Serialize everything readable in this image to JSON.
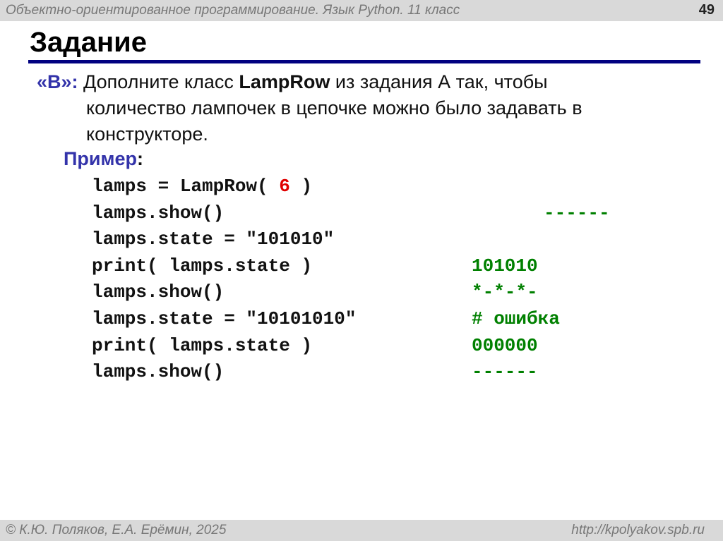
{
  "header": {
    "course": "Объектно-ориентированное программирование. Язык Python. 11 класс",
    "page": "49"
  },
  "title": "Задание",
  "task": {
    "label": "«B»:",
    "text_before": " Дополните класс ",
    "class_name": "LampRow",
    "text_line1_after": " из задания А так, чтобы",
    "line2": "количество лампочек в цепочке можно было задавать в",
    "line3": "конструкторе."
  },
  "example": {
    "label": "Пример",
    "colon": ":",
    "code": [
      {
        "pre": "lamps = LampRow( ",
        "arg": "6",
        "post": " )",
        "output": ""
      },
      {
        "code": "lamps.show()",
        "output": "------",
        "wide": true
      },
      {
        "code": "lamps.state = \"101010\"",
        "output": ""
      },
      {
        "code": "print( lamps.state )",
        "output": "101010"
      },
      {
        "code": "lamps.show()",
        "output": "*-*-*-"
      },
      {
        "code": "lamps.state = \"10101010\"",
        "output": "# ошибка"
      },
      {
        "code": "print( lamps.state )",
        "output": "000000"
      },
      {
        "code": "lamps.show()",
        "output": "------"
      }
    ]
  },
  "footer": {
    "authors": "© К.Ю. Поляков, Е.А. Ерёмин, 2025",
    "url": "http://kpolyakov.spb.ru"
  }
}
